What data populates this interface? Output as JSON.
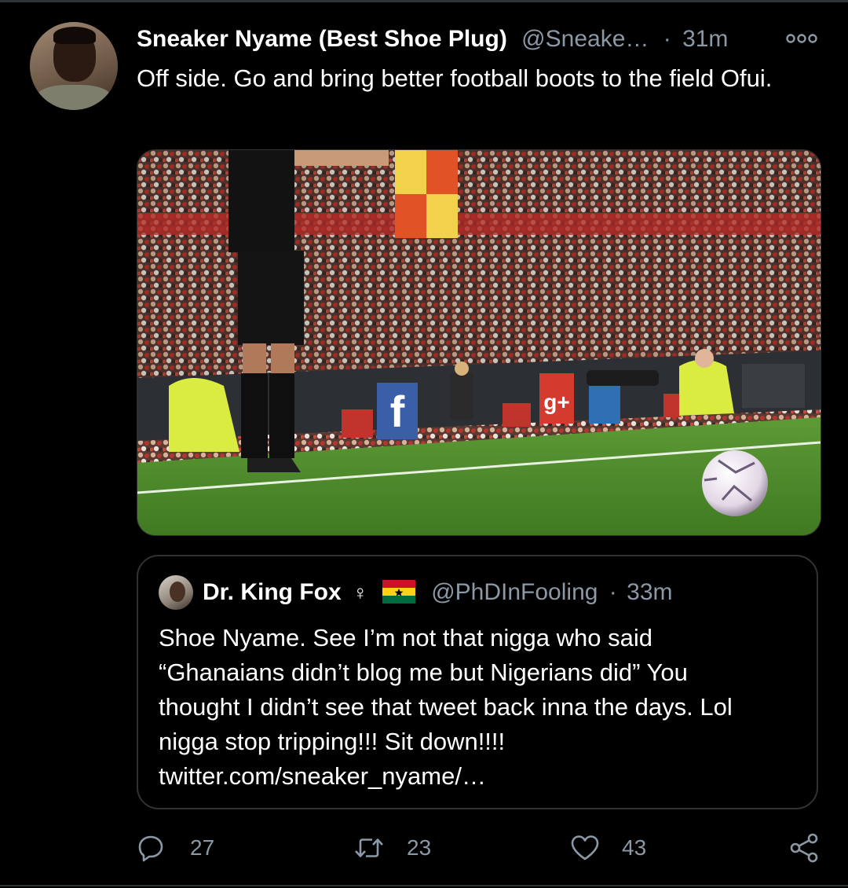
{
  "tweet": {
    "display_name": "Sneaker Nyame (Best Shoe Plug)",
    "handle": "@Sneake…",
    "separator": "·",
    "time": "31m",
    "text": "Off side. Go and bring better football boots to the field Ofui.",
    "more_icon": "more-options-icon"
  },
  "quoted_tweet": {
    "display_name": "Dr. King Fox",
    "name_symbol": "♀",
    "flag": "ghana-flag",
    "handle": "@PhDInFooling",
    "separator": "·",
    "time": "33m",
    "text_lines": [
      "Shoe Nyame. See I’m not that nigga who said",
      "“Ghanaians didn’t blog me but Nigerians did” You",
      "thought I didn’t see that tweet back inna the days. Lol",
      "nigga stop tripping!!! Sit down!!!!",
      "twitter.com/sneaker_nyame/…"
    ]
  },
  "actions": {
    "reply_count": "27",
    "retweet_count": "23",
    "like_count": "43"
  },
  "colors": {
    "background": "#000000",
    "text_primary": "#ffffff",
    "text_secondary": "#8b98a5",
    "border": "#2f3336"
  }
}
